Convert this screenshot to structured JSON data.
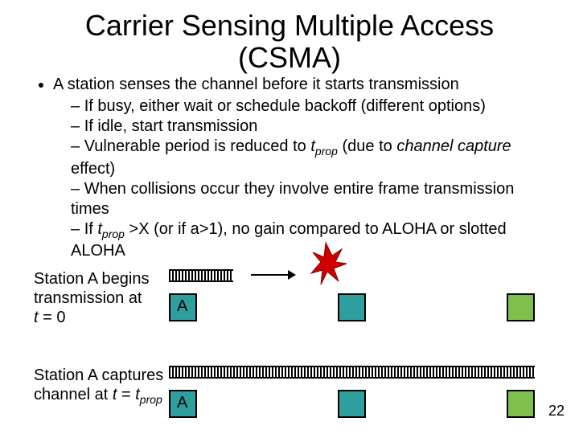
{
  "title_line1": "Carrier Sensing Multiple Access",
  "title_line2": "(CSMA)",
  "bullet_main": "A station senses the channel before it starts transmission",
  "sub": {
    "b1": "If busy, either wait or schedule backoff (different options)",
    "b2": "If idle, start transmission",
    "b3_pre": "Vulnerable period is reduced to ",
    "b3_var": "t",
    "b3_sub": "prop",
    "b3_mid": " (due to ",
    "b3_it": "channel capture",
    "b3_post": " effect)",
    "b4": "When collisions occur they involve entire frame transmission times",
    "b5_pre": "If ",
    "b5_var": "t",
    "b5_sub": "prop",
    "b5_post": " >X (or if a>1), no gain compared to ALOHA or slotted ALOHA"
  },
  "captionA_l1": "Station A begins",
  "captionA_l2": "transmission at",
  "captionA_l3_pre": "",
  "captionA_l3_it": "t",
  "captionA_l3_post": " = 0",
  "captionB_l1": "Station A captures",
  "captionB_l2_pre": "channel at ",
  "captionB_l2_it1": "t",
  "captionB_l2_mid": " = ",
  "captionB_l2_it2": "t",
  "captionB_l2_sub": "prop",
  "labelA": "A",
  "slide_number": "22"
}
